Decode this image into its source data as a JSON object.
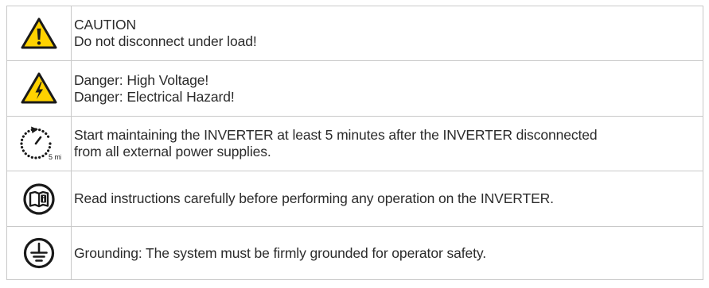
{
  "rows": [
    {
      "icon": "caution-exclamation-triangle-icon",
      "lines": [
        "CAUTION",
        "Do not disconnect under load!"
      ]
    },
    {
      "icon": "high-voltage-triangle-icon",
      "lines": [
        "Danger: High Voltage!",
        "Danger: Electrical Hazard!"
      ]
    },
    {
      "icon": "five-minute-timer-icon",
      "icon_label": "5 min",
      "lines": [
        "Start maintaining the INVERTER at least 5 minutes after the INVERTER disconnected",
        "from all external power supplies."
      ]
    },
    {
      "icon": "read-manual-book-icon",
      "lines": [
        "Read instructions carefully before performing any operation on the INVERTER."
      ]
    },
    {
      "icon": "protective-ground-icon",
      "lines": [
        "Grounding: The system must be firmly grounded for operator safety."
      ]
    }
  ],
  "colors": {
    "warning_yellow": "#FFD200",
    "outline": "#1a1a1a",
    "border": "#c9c9c9",
    "text": "#2b2b2b"
  }
}
